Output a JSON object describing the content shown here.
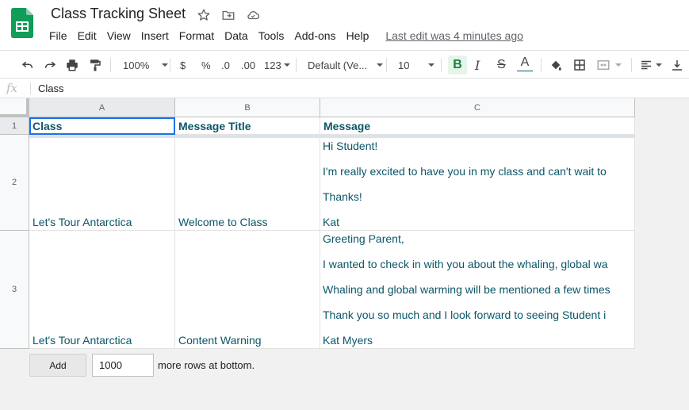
{
  "doc": {
    "title": "Class Tracking Sheet"
  },
  "menu": [
    "File",
    "Edit",
    "View",
    "Insert",
    "Format",
    "Data",
    "Tools",
    "Add-ons",
    "Help"
  ],
  "last_edit": "Last edit was 4 minutes ago",
  "toolbar": {
    "zoom": "100%",
    "currency": "$",
    "percent": "%",
    "dec_less": ".0",
    "dec_more": ".00",
    "more_formats": "123",
    "font": "Default (Ve...",
    "font_size": "10",
    "bold": "B",
    "italic": "I",
    "strike": "S",
    "text_color_letter": "A",
    "text_color": "#0b5667"
  },
  "formula_bar": {
    "fx": "fx",
    "value": "Class"
  },
  "columns": [
    "A",
    "B",
    "C"
  ],
  "rows": [
    "1",
    "2",
    "3"
  ],
  "header": {
    "a": "Class",
    "b": "Message Title",
    "c": "Message"
  },
  "row2": {
    "a": "Let's Tour Antarctica",
    "b": "Welcome to Class",
    "c": [
      "Hi Student!",
      "I'm really excited to have you in my class and can't wait to",
      "Thanks!",
      "Kat"
    ]
  },
  "row3": {
    "a": "Let's Tour Antarctica",
    "b": "Content Warning",
    "c": [
      "Greeting Parent,",
      "I wanted to check in with you about the whaling, global wa",
      "Whaling and global warming will be mentioned a few times",
      "Thank you so much and I look forward to seeing Student i",
      "Kat Myers"
    ]
  },
  "footer": {
    "add": "Add",
    "rows_value": "1000",
    "more_rows": "more rows at bottom."
  },
  "colors": {
    "cell_text": "#0b5667",
    "selection": "#1a73e8",
    "sheets_green": "#0f9d58"
  }
}
